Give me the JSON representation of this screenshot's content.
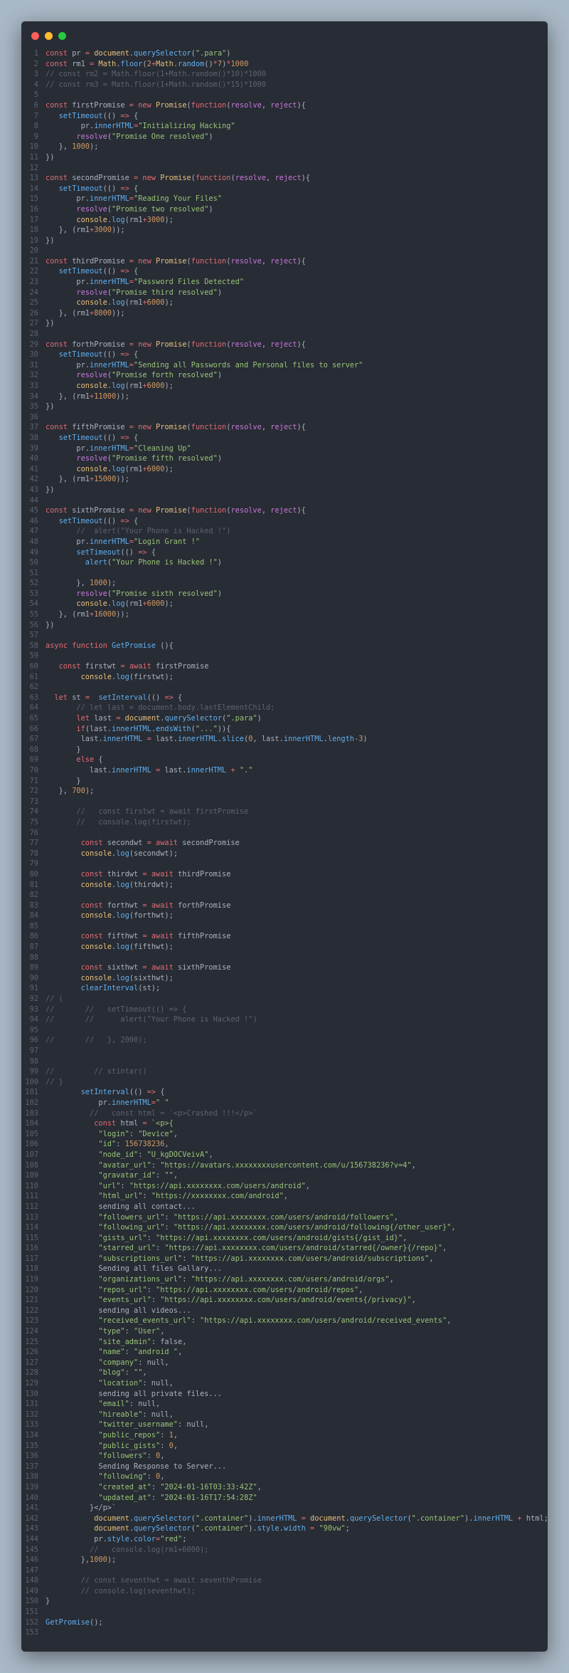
{
  "window": {
    "controls": [
      {
        "name": "close-dot",
        "color": "#ff5f57"
      },
      {
        "name": "minimize-dot",
        "color": "#febc2e"
      },
      {
        "name": "maximize-dot",
        "color": "#28c840"
      }
    ]
  },
  "theme": {
    "background": "#282c34",
    "keyword": "#e06c75",
    "function": "#61afef",
    "string": "#98c379",
    "number": "#d19a66",
    "comment": "#5c6370",
    "param": "#c678dd",
    "builtin": "#e5c07b"
  },
  "code": {
    "lines": [
      "const pr = document.querySelector(\".para\")",
      "const rm1 = Math.floor(2+Math.random()*7)*1000",
      "// const rm2 = Math.floor(1+Math.random()*10)*1000",
      "// const rm3 = Math.floor(1+Math.random()*15)*1000",
      "",
      "const firstPromise = new Promise(function(resolve, reject){",
      "   setTimeout(() => {",
      "        pr.innerHTML=\"Initializing Hacking\"",
      "       resolve(\"Promise One resolved\")",
      "   }, 1000);",
      "})",
      "",
      "const secondPromise = new Promise(function(resolve, reject){",
      "   setTimeout(() => {",
      "       pr.innerHTML=\"Reading Your Files\"",
      "       resolve(\"Promise two resolved\")",
      "       console.log(rm1+3000);",
      "   }, (rm1+3000));",
      "})",
      "",
      "const thirdPromise = new Promise(function(resolve, reject){",
      "   setTimeout(() => {",
      "       pr.innerHTML=\"Password Files Detected\"",
      "       resolve(\"Promise third resolved\")",
      "       console.log(rm1+6000);",
      "   }, (rm1+8000));",
      "})",
      "",
      "const forthPromise = new Promise(function(resolve, reject){",
      "   setTimeout(() => {",
      "       pr.innerHTML=\"Sending all Passwords and Personal files to server\"",
      "       resolve(\"Promise forth resolved\")",
      "       console.log(rm1+6000);",
      "   }, (rm1+11000));",
      "})",
      "",
      "const fifthPromise = new Promise(function(resolve, reject){",
      "   setTimeout(() => {",
      "       pr.innerHTML=\"Cleaning Up\"",
      "       resolve(\"Promise fifth resolved\")",
      "       console.log(rm1+6000);",
      "   }, (rm1+15000));",
      "})",
      "",
      "const sixthPromise = new Promise(function(resolve, reject){",
      "   setTimeout(() => {",
      "       //  alert(\"Your Phone is Hacked !\")",
      "       pr.innerHTML=\"Login Grant !\"",
      "       setTimeout(() => {",
      "         alert(\"Your Phone is Hacked !\")",
      "",
      "       }, 1000);",
      "       resolve(\"Promise sixth resolved\")",
      "       console.log(rm1+6000);",
      "   }, (rm1+16000));",
      "})",
      "",
      "async function GetPromise (){",
      "",
      "   const firstwt = await firstPromise",
      "        console.log(firstwt);",
      "",
      "  let st =  setInterval(() => {",
      "       // let last = document.body.lastElementChild;",
      "       let last = document.querySelector(\".para\")",
      "       if(last.innerHTML.endsWith(\"...\")){",
      "        last.innerHTML = last.innerHTML.slice(0, last.innerHTML.length-3)",
      "       }",
      "       else {",
      "          last.innerHTML = last.innerHTML + \".\"",
      "       }",
      "   }, 700);",
      "",
      "       //   const firstwt = await firstPromise",
      "       //   console.log(firstwt);",
      "",
      "        const secondwt = await secondPromise",
      "        console.log(secondwt);",
      "",
      "        const thirdwt = await thirdPromise",
      "        console.log(thirdwt);",
      "",
      "        const forthwt = await forthPromise",
      "        console.log(forthwt);",
      "",
      "        const fifthwt = await fifthPromise",
      "        console.log(fifthwt);",
      "",
      "        const sixthwt = await sixthPromise",
      "        console.log(sixthwt);",
      "        clearInterval(st);",
      "// (",
      "//       //   setTimeout(() => {",
      "//       //      alert(\"Your Phone is Hacked !\")",
      "",
      "//       //   }, 2000);",
      "",
      "",
      "//         // stintar()",
      "// }",
      "        setInterval(() => {",
      "            pr.innerHTML=\" \"",
      "          //   const html = `<p>Crashed !!!</p>`",
      "           const html = `<p>{",
      "            \"login\": \"Device\",",
      "            \"id\": 156738236,",
      "            \"node_id\": \"U_kgDOCVeivA\",",
      "            \"avatar_url\": \"https://avatars.xxxxxxxxusercontent.com/u/156738236?v=4\",",
      "            \"gravatar_id\": \"\",",
      "            \"url\": \"https://api.xxxxxxxx.com/users/android\",",
      "            \"html_url\": \"https://xxxxxxxx.com/android\",",
      "            sending all contact...",
      "            \"followers_url\": \"https://api.xxxxxxxx.com/users/android/followers\",",
      "            \"following_url\": \"https://api.xxxxxxxx.com/users/android/following{/other_user}\",",
      "            \"gists_url\": \"https://api.xxxxxxxx.com/users/android/gists{/gist_id}\",",
      "            \"starred_url\": \"https://api.xxxxxxxx.com/users/android/starred{/owner}{/repo}\",",
      "            \"subscriptions_url\": \"https://api.xxxxxxxx.com/users/android/subscriptions\",",
      "            Sending all files Gallary...",
      "            \"organizations_url\": \"https://api.xxxxxxxx.com/users/android/orgs\",",
      "            \"repos_url\": \"https://api.xxxxxxxx.com/users/android/repos\",",
      "            \"events_url\": \"https://api.xxxxxxxx.com/users/android/events{/privacy}\",",
      "            sending all videos...",
      "            \"received_events_url\": \"https://api.xxxxxxxx.com/users/android/received_events\",",
      "            \"type\": \"User\",",
      "            \"site_admin\": false,",
      "            \"name\": \"android \",",
      "            \"company\": null,",
      "            \"blog\": \"\",",
      "            \"location\": null,",
      "            sending all private files...",
      "            \"email\": null,",
      "            \"hireable\": null,",
      "            \"twitter_username\": null,",
      "            \"public_repos\": 1,",
      "            \"public_gists\": 0,",
      "            \"followers\": 0,",
      "            Sending Response to Server...",
      "            \"following\": 0,",
      "            \"created_at\": \"2024-01-16T03:33:42Z\",",
      "            \"updated_at\": \"2024-01-16T17:54:28Z\"",
      "          }</p>`",
      "           document.querySelector(\".container\").innerHTML = document.querySelector(\".container\").innerHTML + html;",
      "           document.querySelector(\".container\").style.width = \"90vw\";",
      "           pr.style.color=\"red\";",
      "          //   console.log(rm1+6000);",
      "        },1000);",
      "",
      "        // const seventhwt = await seventhPromise",
      "        // console.log(seventhwt);",
      "}",
      "",
      "GetPromise();",
      ""
    ]
  }
}
